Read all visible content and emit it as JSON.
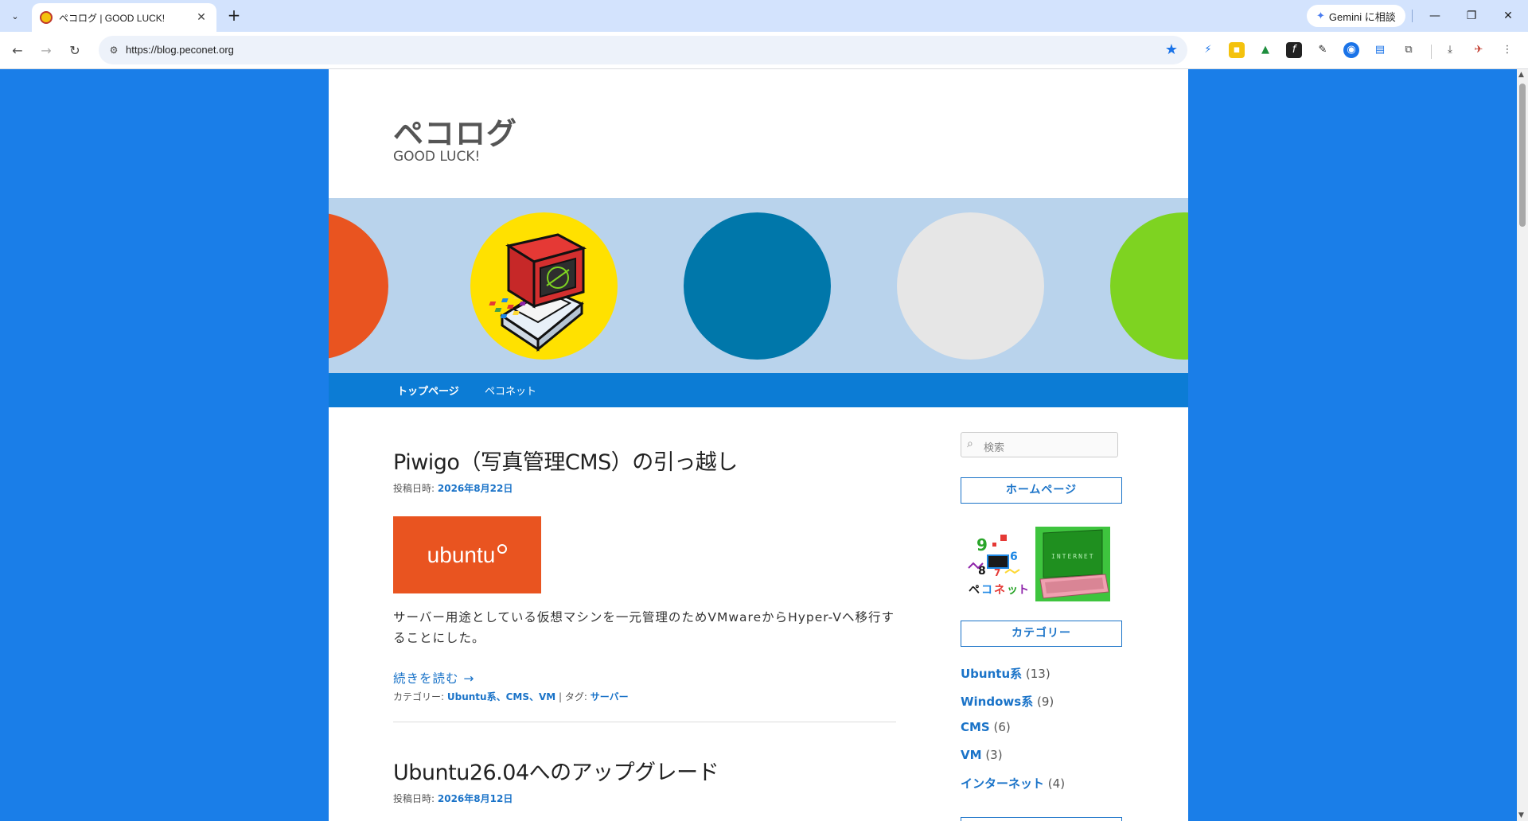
{
  "browser": {
    "tab_title": "ペコログ | GOOD LUCK!",
    "url": "https://blog.peconet.org",
    "gemini_label": "Gemini に相談",
    "new_tab_symbol": "+",
    "tab_close_symbol": "✕"
  },
  "site": {
    "title": "ペコログ",
    "description": "GOOD LUCK!"
  },
  "header_circles": [
    {
      "color": "#e95420"
    },
    {
      "color": "#ffe100"
    },
    {
      "color": "#0077aa"
    },
    {
      "color": "#e6e6e6"
    },
    {
      "color": "#7ed321"
    }
  ],
  "nav": {
    "items": [
      {
        "label": "トップページ"
      },
      {
        "label": "ペコネット"
      }
    ]
  },
  "posts": [
    {
      "title": "Piwigo（写真管理CMS）の引っ越し",
      "date_label": "投稿日時:",
      "date": "2026年8月22日",
      "thumb_text": "ubuntu",
      "excerpt": "サーバー用途としている仮想マシンを一元管理のためVMwareからHyper-Vへ移行することにした。",
      "read_more": "続きを読む →",
      "category_label": "カテゴリー:",
      "categories": "Ubuntu系、CMS、VM",
      "tag_sep": "| タグ:",
      "tags": "サーバー"
    },
    {
      "title": "Ubuntu26.04へのアップグレード",
      "date_label": "投稿日時:",
      "date": "2026年8月12日"
    }
  ],
  "sidebar": {
    "search_placeholder": "検索",
    "homepage_title": "ホームページ",
    "banner_label": "ペコネット",
    "banner_internet": "INTERNET",
    "category_title": "カテゴリー",
    "categories": [
      {
        "name": "Ubuntu系",
        "count": "(13)"
      },
      {
        "name": "Windows系",
        "count": "(9)"
      },
      {
        "name": "CMS",
        "count": "(6)"
      },
      {
        "name": "VM",
        "count": "(3)"
      },
      {
        "name": "インターネット",
        "count": "(4)"
      }
    ]
  },
  "colors": {
    "background": "#1a7ee8",
    "nav": "#0c7cd5",
    "link": "#1a73c8",
    "header_bg": "#b9d3ec"
  }
}
